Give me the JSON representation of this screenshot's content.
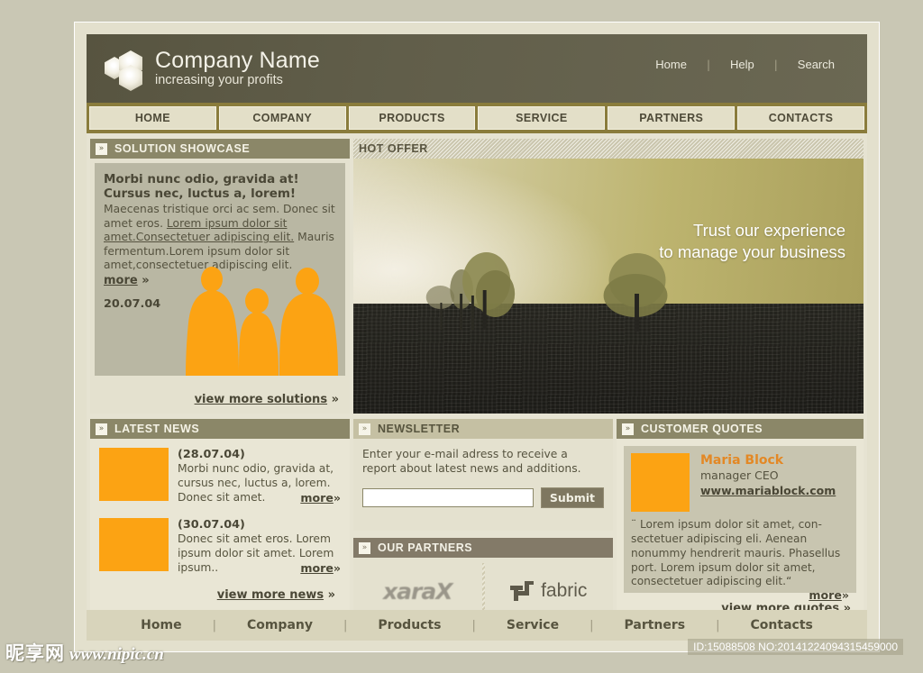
{
  "header": {
    "company_name": "Company Name",
    "tagline": "increasing your profits",
    "logo_icon": "hexagon-cluster-logo",
    "top_links": [
      {
        "label": "Home"
      },
      {
        "label": "Help"
      },
      {
        "label": "Search"
      }
    ],
    "separator": "|"
  },
  "main_nav": [
    {
      "label": "HOME"
    },
    {
      "label": "COMPANY"
    },
    {
      "label": "PRODUCTS"
    },
    {
      "label": "SERVICE"
    },
    {
      "label": "PARTNERS"
    },
    {
      "label": "CONTACTS"
    }
  ],
  "showcase": {
    "section_title": "SOLUTION SHOWCASE",
    "chevron_icon": "double-chevron-right-icon",
    "headline_line1": "Morbi nunc odio, gravida at!",
    "headline_line2": "Cursus nec, luctus a, lorem!",
    "body_pre": "Maecenas tristique orci ac sem. Donec sit amet eros. ",
    "body_link": "Lorem ipsum dolor sit amet.Consectetuer adipiscing elit.",
    "body_post": " Mauris fermentum.Lorem ipsum dolor sit amet,consectetuer adipiscing elit.",
    "more_label": "more",
    "more_arrow": "»",
    "date": "20.07.04",
    "view_more_label": "view more solutions",
    "view_more_arrow": "»",
    "illustration": "three-orange-people-silhouettes"
  },
  "hot_offer": {
    "section_title": "HOT OFFER",
    "tagline_line1": "Trust our experience",
    "tagline_line2": "to manage your business",
    "image_alt": "sunset-field-with-trees-photo"
  },
  "latest_news": {
    "section_title": "LATEST NEWS",
    "chevron_icon": "double-chevron-right-icon",
    "items": [
      {
        "date": "(28.07.04)",
        "text": "Morbi nunc odio, gravida at, cursus nec, luctus a, lorem. Donec sit amet.",
        "more_label": "more",
        "more_arrow": "»",
        "thumb": "orange-thumbnail"
      },
      {
        "date": "(30.07.04)",
        "text": "Donec sit amet eros. Lorem ipsum dolor sit amet. Lorem ipsum..",
        "more_label": "more",
        "more_arrow": "»",
        "thumb": "orange-thumbnail"
      }
    ],
    "view_more_label": "view more news",
    "view_more_arrow": "»"
  },
  "newsletter": {
    "section_title": "NEWSLETTER",
    "chevron_icon": "double-chevron-right-icon",
    "description": "Enter your e-mail adress to receive a report about latest news and additions.",
    "input_value": "",
    "input_placeholder": "",
    "submit_label": "Submit"
  },
  "our_partners": {
    "section_title": "OUR PARTNERS",
    "chevron_icon": "double-chevron-right-icon",
    "logos": [
      {
        "name": "xara-logo",
        "label": "xaraX"
      },
      {
        "name": "fabric-logo",
        "label": "fabric"
      }
    ]
  },
  "customer_quotes": {
    "section_title": "CUSTOMER QUOTES",
    "chevron_icon": "double-chevron-right-icon",
    "avatar": "orange-avatar",
    "name": "Maria Block",
    "role": "manager CEO",
    "website": "www.mariablock.com",
    "quote": "¨ Lorem ipsum dolor sit amet, con-sectetuer adipiscing eli.  Aenean nonummy hendrerit mauris. Phasellus port.  Lorem ipsum dolor sit amet, consectetuer adipiscing elit.“",
    "more_label": "more",
    "more_arrow": "»",
    "view_more_label": "view more quotes",
    "view_more_arrow": "»"
  },
  "footer_nav": {
    "separator": "|",
    "items": [
      {
        "label": "Home"
      },
      {
        "label": "Company"
      },
      {
        "label": "Products"
      },
      {
        "label": "Service"
      },
      {
        "label": "Partners"
      },
      {
        "label": "Contacts"
      }
    ]
  },
  "watermark": {
    "site_cn": "昵享网",
    "site_url": "www.nipic.cn",
    "id_text": "ID:15088508 NO:20141224094315459000"
  },
  "colors": {
    "page_bg": "#c9c7b4",
    "header_bg": "#5d5a45",
    "nav_bar": "#8a7c3c",
    "nav_tab": "#e3dfc8",
    "accent_orange": "#fca313",
    "quote_name": "#e38825",
    "section_olive": "#8b8768",
    "section_tan": "#c5c0a3",
    "section_brown": "#837a68",
    "body_text": "#55523f"
  }
}
